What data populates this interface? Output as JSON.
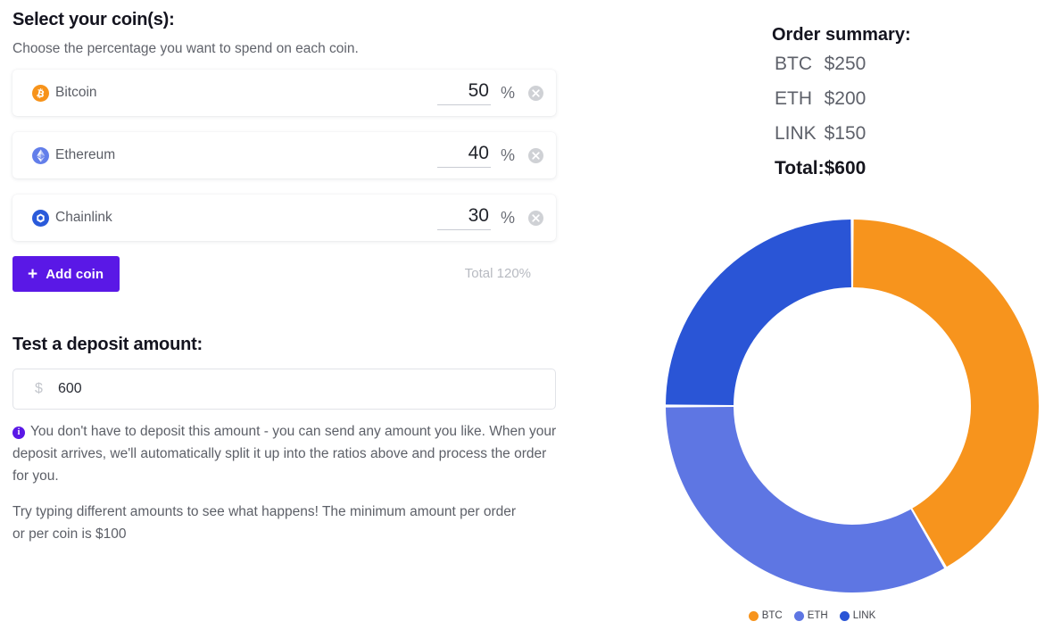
{
  "coins_panel": {
    "title": "Select your coin(s):",
    "subtitle": "Choose the percentage you want to spend on each coin.",
    "percent_sign": "%",
    "coins": [
      {
        "name": "Bitcoin",
        "symbol": "BTC",
        "percent": "50",
        "icon": "bitcoin-icon",
        "color": "#F7941D"
      },
      {
        "name": "Ethereum",
        "symbol": "ETH",
        "percent": "40",
        "icon": "ethereum-icon",
        "color": "#627EEA"
      },
      {
        "name": "Chainlink",
        "symbol": "LINK",
        "percent": "30",
        "icon": "chainlink-icon",
        "color": "#2A5ADA"
      }
    ],
    "add_coin_label": "Add coin",
    "add_coin_plus": "+",
    "total_label": "Total 120%"
  },
  "deposit_panel": {
    "title": "Test a deposit amount:",
    "currency_prefix": "$",
    "amount": "600",
    "placeholder": "0",
    "info_icon": "i",
    "info_text": "You don't have to deposit this amount - you can send any amount you like. When your deposit arrives, we'll automatically split it up into the ratios above and process the order for you.",
    "hint_text": "Try typing different amounts to see what happens! The minimum amount per order or per coin is $100"
  },
  "order_summary": {
    "title": "Order summary:",
    "rows": [
      {
        "label": "BTC",
        "value": "$250"
      },
      {
        "label": "ETH",
        "value": "$200"
      },
      {
        "label": "LINK",
        "value": "$150"
      }
    ],
    "total_label": "Total:",
    "total_value": "$600"
  },
  "chart_data": {
    "type": "pie",
    "title": "",
    "variant": "donut",
    "categories": [
      "BTC",
      "ETH",
      "LINK"
    ],
    "values": [
      250,
      200,
      150
    ],
    "total": 600,
    "percentages": [
      41.67,
      33.33,
      25.0
    ],
    "colors": [
      "#F7941D",
      "#5E76E3",
      "#2A55D6"
    ],
    "legend": [
      "BTC",
      "ETH",
      "LINK"
    ],
    "legend_position": "bottom",
    "start_angle_deg": 0,
    "direction": "clockwise",
    "inner_radius": 133,
    "outer_radius": 209,
    "grid": false
  },
  "theme": {
    "accent_purple": "#5A18E6",
    "text_dark": "#14141F",
    "text_muted": "#5D6068",
    "text_light": "#B7BAC1",
    "border": "#E1E3E8"
  }
}
